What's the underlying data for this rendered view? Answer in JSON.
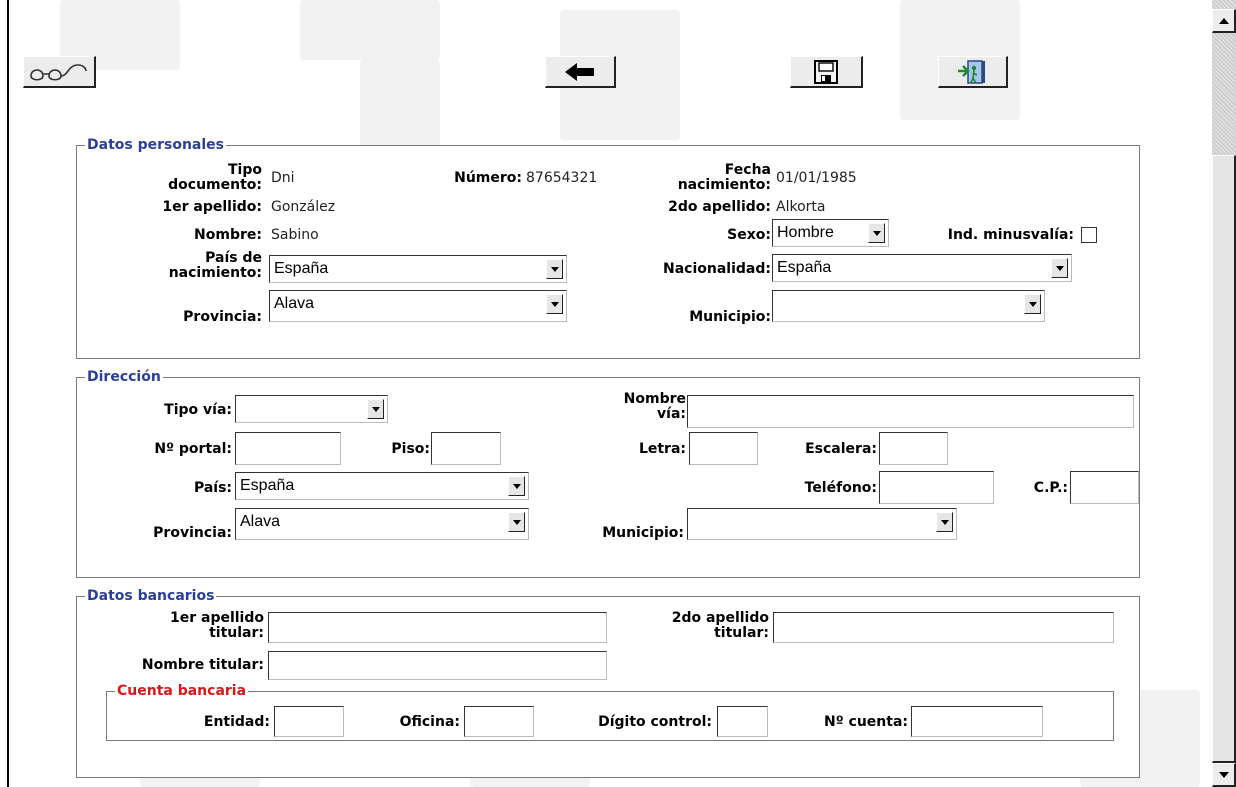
{
  "toolbar": {
    "view_icon": "glasses-icon",
    "back_icon": "arrow-left-icon",
    "save_icon": "floppy-disk-icon",
    "exit_icon": "exit-door-icon"
  },
  "personal": {
    "legend": "Datos personales",
    "tipo_label_1": "Tipo",
    "tipo_label_2": "documento:",
    "tipo_value": "Dni",
    "numero_label": "Número:",
    "numero_value": "87654321",
    "fecha_label_1": "Fecha",
    "fecha_label_2": "nacimiento:",
    "fecha_value": "01/01/1985",
    "apellido1_label": "1er apellido:",
    "apellido1_value": "González",
    "apellido2_label": "2do apellido:",
    "apellido2_value": "Alkorta",
    "nombre_label": "Nombre:",
    "nombre_value": "Sabino",
    "sexo_label": "Sexo:",
    "sexo_value": "Hombre",
    "minusvalia_label": "Ind. minusvalía:",
    "pais_label_1": "País de",
    "pais_label_2": "nacimiento:",
    "pais_value": "España",
    "nacionalidad_label": "Nacionalidad:",
    "nacionalidad_value": "España",
    "provincia_label": "Provincia:",
    "provincia_value": "Alava",
    "municipio_label": "Municipio:",
    "municipio_value": ""
  },
  "address": {
    "legend": "Dirección",
    "tipo_via_label": "Tipo vía:",
    "tipo_via_value": "",
    "nombre_via_label_1": "Nombre",
    "nombre_via_label_2": "vía:",
    "portal_label": "Nº portal:",
    "piso_label": "Piso:",
    "letra_label": "Letra:",
    "escalera_label": "Escalera:",
    "pais_label": "País:",
    "pais_value": "España",
    "telefono_label": "Teléfono:",
    "cp_label": "C.P.:",
    "provincia_label": "Provincia:",
    "provincia_value": "Alava",
    "municipio_label": "Municipio:",
    "municipio_value": ""
  },
  "bank": {
    "legend": "Datos bancarios",
    "apellido1_label_1": "1er apellido",
    "apellido1_label_2": "titular:",
    "apellido2_label_1": "2do apellido",
    "apellido2_label_2": "titular:",
    "nombre_label": "Nombre titular:",
    "account_legend": "Cuenta bancaria",
    "entidad_label": "Entidad:",
    "oficina_label": "Oficina:",
    "digito_label": "Dígito control:",
    "cuenta_label": "Nº cuenta:"
  },
  "colors": {
    "legend_blue": "#2a3f9a",
    "legend_red": "#d81818",
    "background_shape": "#f2f2f2"
  }
}
